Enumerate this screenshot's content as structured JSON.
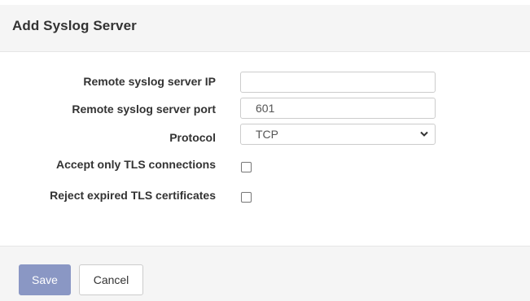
{
  "dialog": {
    "title": "Add Syslog Server"
  },
  "form": {
    "server_ip": {
      "label": "Remote syslog server IP",
      "value": ""
    },
    "server_port": {
      "label": "Remote syslog server port",
      "value": "601"
    },
    "protocol": {
      "label": "Protocol",
      "selected": "TCP"
    },
    "accept_tls": {
      "label": "Accept only TLS connections",
      "checked": false
    },
    "reject_expired": {
      "label": "Reject expired TLS certificates",
      "checked": false
    }
  },
  "footer": {
    "save_label": "Save",
    "cancel_label": "Cancel"
  },
  "colors": {
    "save_button": "#8a97c4",
    "header_bg": "#f5f5f5"
  },
  "icons": {
    "protocol_dropdown": "chevron-down-icon"
  }
}
